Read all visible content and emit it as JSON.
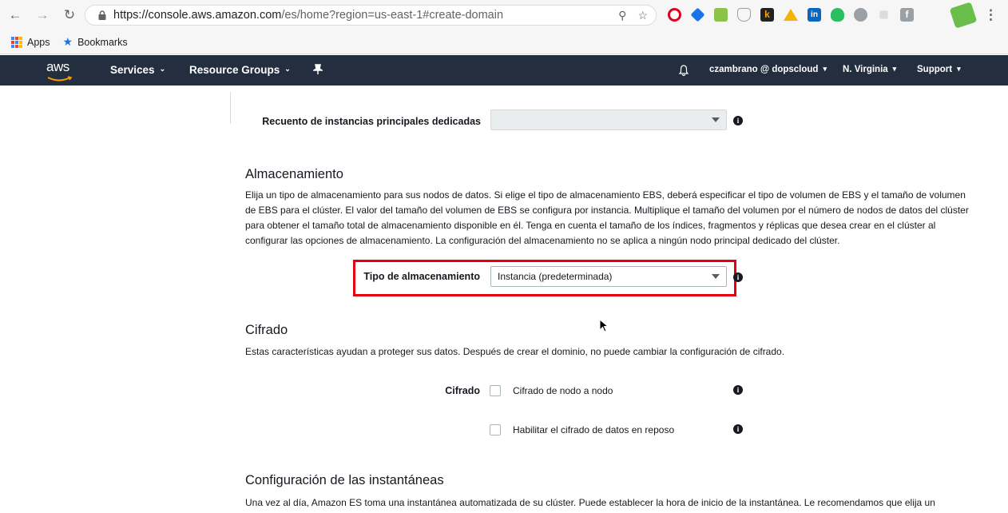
{
  "browser": {
    "url_host": "https://console.aws.amazon.com",
    "url_path": "/es/home?region=us-east-1#create-domain",
    "bookmarks": [
      {
        "label": "Apps",
        "icon": "apps-grid-icon"
      },
      {
        "label": "Bookmarks",
        "icon": "star-icon"
      }
    ]
  },
  "aws_nav": {
    "logo_text": "aws",
    "services": "Services",
    "resource_groups": "Resource Groups",
    "account": "czambrano @ dopscloud",
    "region": "N. Virginia",
    "support": "Support"
  },
  "dedicated_master": {
    "label": "Recuento de instancias principales dedicadas",
    "value": ""
  },
  "storage": {
    "title": "Almacenamiento",
    "description": "Elija un tipo de almacenamiento para sus nodos de datos. Si elige el tipo de almacenamiento EBS, deberá especificar el tipo de volumen de EBS y el tamaño de volumen de EBS para el clúster. El valor del tamaño del volumen de EBS se configura por instancia. Multiplique el tamaño del volumen por el número de nodos de datos del clúster para obtener el tamaño total de almacenamiento disponible en él. Tenga en cuenta el tamaño de los índices, fragmentos y réplicas que desea crear en el clúster al configurar las opciones de almacenamiento. La configuración del almacenamiento no se aplica a ningún nodo principal dedicado del clúster.",
    "type_label": "Tipo de almacenamiento",
    "type_value": "Instancia (predeterminada)"
  },
  "encryption": {
    "title": "Cifrado",
    "description": "Estas características ayudan a proteger sus datos. Después de crear el dominio, no puede cambiar la configuración de cifrado.",
    "label": "Cifrado",
    "option_node_to_node": "Cifrado de nodo a nodo",
    "option_at_rest": "Habilitar el cifrado de datos en reposo"
  },
  "snapshot": {
    "title": "Configuración de las instantáneas",
    "description": "Una vez al día, Amazon ES toma una instantánea automatizada de su clúster. Puede establecer la hora de inicio de la instantánea. Le recomendamos que elija un"
  },
  "colors": {
    "aws_nav_bg": "#232f3e",
    "highlight": "#e3000f"
  }
}
